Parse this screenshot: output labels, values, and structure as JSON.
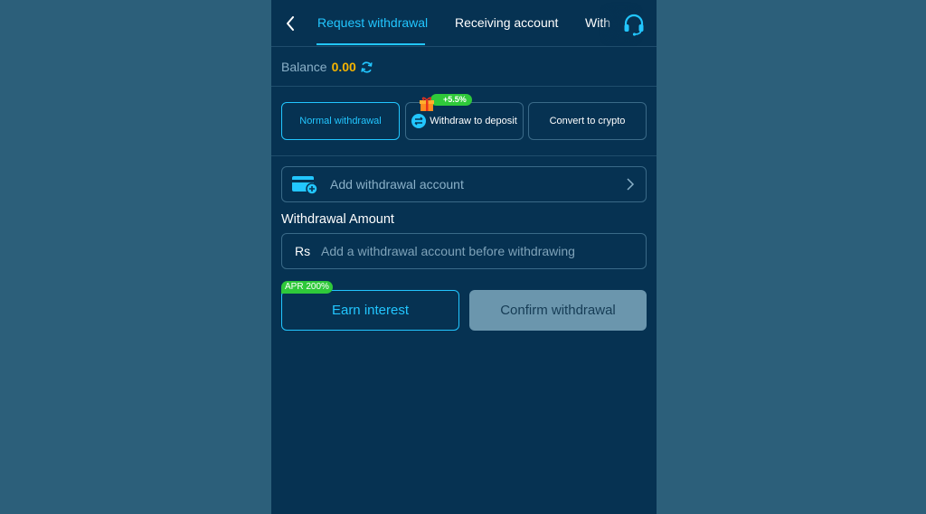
{
  "header": {
    "tabs": [
      {
        "label": "Request withdrawal",
        "active": true
      },
      {
        "label": "Receiving account",
        "active": false
      },
      {
        "label": "With",
        "active": false
      }
    ]
  },
  "balance": {
    "label": "Balance",
    "value": "0.00"
  },
  "methods": [
    {
      "label": "Normal withdrawal",
      "active": true
    },
    {
      "label": "Withdraw to deposit",
      "active": false,
      "badge": "+5.5%"
    },
    {
      "label": "Convert to crypto",
      "active": false
    }
  ],
  "add_account": {
    "label": "Add withdrawal account"
  },
  "amount": {
    "label": "Withdrawal Amount",
    "currency": "Rs",
    "placeholder": "Add a withdrawal account before withdrawing"
  },
  "actions": {
    "earn_label": "Earn interest",
    "apr_badge": "APR 200%",
    "confirm_label": "Confirm withdrawal"
  },
  "colors": {
    "accent": "#22c6ff",
    "balance": "#f5b400",
    "badge_green": "#2fc93a",
    "panel_bg": "#063252",
    "page_bg": "#2c5f7a"
  },
  "icons": [
    "back-arrow-icon",
    "headset-icon",
    "refresh-icon",
    "gift-icon",
    "swap-icon",
    "card-add-icon",
    "chevron-right-icon"
  ]
}
